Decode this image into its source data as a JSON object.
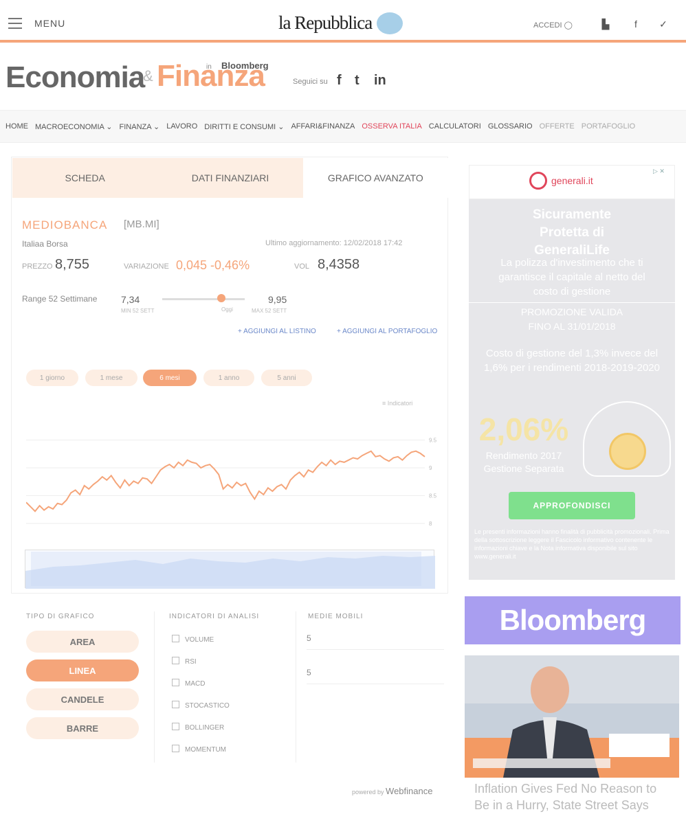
{
  "header": {
    "menu_label": "MENU",
    "logo": "la Repubblica",
    "accedi": "ACCEDI",
    "icons": [
      "user-icon",
      "shopping-bag-icon",
      "facebook-icon",
      "twitter-icon"
    ]
  },
  "brand": {
    "economia": "Economia",
    "amp": "&",
    "finanza": "Finanza",
    "in_label": "in",
    "bloomberg": "Bloomberg",
    "seguici": "Seguici su",
    "social": [
      "f",
      "t",
      "in"
    ]
  },
  "nav": {
    "items": [
      "HOME",
      "MACROECONOMIA ⌄",
      "FINANZA ⌄",
      "LAVORO",
      "DIRITTI E CONSUMI ⌄",
      "AFFARI&FINANZA",
      "OSSERVA ITALIA",
      "CALCULATORI",
      "GLOSSARIO",
      "OFFERTE",
      "PORTAFOGLIO"
    ]
  },
  "tabs": [
    "SCHEDA",
    "DATI FINANZIARI",
    "GRAFICO AVANZATO"
  ],
  "stock": {
    "name": "MEDIOBANCA",
    "code": "[MB.MI]",
    "market": "Italiaa Borsa",
    "updated": "Ultimo aggiornamento: 12/02/2018 17:42",
    "prezzo_label": "PREZZO",
    "prezzo": "8,755",
    "variazione_label": "VARIAZIONE",
    "variazione": "0,045 -0,46%",
    "vol_label": "VOL",
    "vol": "8,4358",
    "range_label": "Range 52 Settimane",
    "range_min": "7,34",
    "range_min_label": "MIN 52 SETT",
    "range_max": "9,95",
    "range_max_label": "MAX 52 SETT",
    "range_mid_label": "Oggi",
    "range_position": 0.72
  },
  "links": [
    "+ AGGIUNGI AL LISTINO",
    "+ AGGIUNGI AL PORTAFOGLIO"
  ],
  "periods": [
    "1 giorno",
    "1 mese",
    "6 mesi",
    "1 anno",
    "5 anni"
  ],
  "chart_legend": "≡ Indicatori",
  "chart_data": {
    "type": "line",
    "ylim": [
      8,
      10
    ],
    "x": [
      0,
      1,
      2,
      3,
      4,
      5,
      6,
      7,
      8,
      9,
      10,
      11,
      12,
      13,
      14,
      15,
      16,
      17,
      18,
      19,
      20,
      21,
      22,
      23,
      24,
      25,
      26,
      27,
      28,
      29,
      30,
      31,
      32,
      33,
      34,
      35,
      36,
      37,
      38,
      39,
      40,
      41,
      42,
      43,
      44,
      45,
      46,
      47,
      48,
      49,
      50,
      51,
      52,
      53,
      54,
      55,
      56,
      57,
      58,
      59,
      60,
      61,
      62,
      63,
      64,
      65,
      66,
      67,
      68,
      69,
      70,
      71,
      72,
      73,
      74,
      75,
      76,
      77,
      78,
      79,
      80,
      81,
      82,
      83,
      84,
      85,
      86,
      87,
      88,
      89
    ],
    "values": [
      8.38,
      8.3,
      8.22,
      8.32,
      8.24,
      8.3,
      8.26,
      8.36,
      8.34,
      8.42,
      8.55,
      8.6,
      8.52,
      8.68,
      8.62,
      8.7,
      8.76,
      8.84,
      8.78,
      8.86,
      8.74,
      8.64,
      8.78,
      8.68,
      8.76,
      8.72,
      8.82,
      8.8,
      8.72,
      8.84,
      8.96,
      9.02,
      9.06,
      9.0,
      9.1,
      9.04,
      9.14,
      9.1,
      9.08,
      9.0,
      9.04,
      9.06,
      8.98,
      8.88,
      8.62,
      8.7,
      8.64,
      8.74,
      8.68,
      8.72,
      8.56,
      8.44,
      8.58,
      8.52,
      8.64,
      8.58,
      8.66,
      8.7,
      8.62,
      8.78,
      8.86,
      8.92,
      8.84,
      8.96,
      8.92,
      9.02,
      9.1,
      9.04,
      9.14,
      9.06,
      9.12,
      9.1,
      9.14,
      9.18,
      9.16,
      9.22,
      9.26,
      9.3,
      9.2,
      9.22,
      9.16,
      9.12,
      9.18,
      9.2,
      9.14,
      9.22,
      9.28,
      9.3,
      9.26,
      9.2
    ],
    "yticks": [
      "8",
      "8.5",
      "9",
      "9.5"
    ]
  },
  "chart_type_title": "TIPO DI GRAFICO",
  "chart_types": [
    "AREA",
    "LINEA",
    "CANDELE",
    "BARRE"
  ],
  "indicators_title": "INDICATORI DI ANALISI",
  "indicators": [
    "VOLUME",
    "RSI",
    "MACD",
    "STOCASTICO",
    "BOLLINGER",
    "MOMENTUM"
  ],
  "medie_title": "MEDIE MOBILI",
  "medie": [
    "5",
    "5"
  ],
  "powered": {
    "label": "powered by",
    "brand": "Webfinance"
  },
  "ad": {
    "brand": "generali.it",
    "ad_choices": "▷ ✕",
    "headline": "Sicuramente Protetta di GeneraliLife",
    "body": "La polizza d'investimento che ti garantisce il capitale al netto del costo di gestione",
    "promo": "PROMOZIONE VALIDA FINO AL 31/01/2018",
    "cost": "Costo di gestione del 1,3% invece del 1,6% per i rendimenti 2018-2019-2020",
    "percent": "2,06%",
    "percent_caption": "Rendimento 2017 Gestione Separata",
    "button": "APPROFONDISCI",
    "fine": "Le presenti informazioni hanno finalità di pubblicità promozionali. Prima della sottoscrizione leggere il Fascicolo informativo contenente le informazioni chiave e la Nota informativa disponibile sul sito www.generali.it"
  },
  "bloomberg_banner": "Bloomberg",
  "video": {
    "title": "Inflation Gives Fed No Reason to Be in a Hurry, State Street Says"
  }
}
